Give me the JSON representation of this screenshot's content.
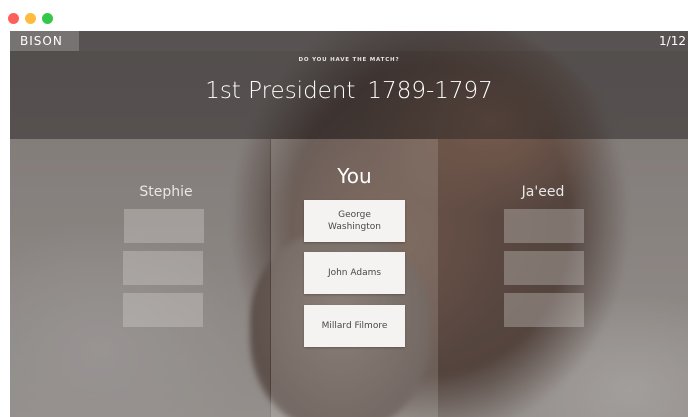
{
  "window": {
    "traffic_lights": [
      "close",
      "minimize",
      "zoom"
    ],
    "colors": {
      "close": "#fc605c",
      "minimize": "#fdbc40",
      "zoom": "#34c84a"
    }
  },
  "header": {
    "brand": "BISON",
    "progress": "1/12"
  },
  "banner": {
    "prompt": "DO YOU HAVE THE MATCH?",
    "question_title": "1st President",
    "question_years": "1789-1797"
  },
  "players": {
    "left": "Stephie",
    "center": "You",
    "right": "Ja'eed"
  },
  "choices": [
    {
      "label": "George Washington"
    },
    {
      "label": "John Adams"
    },
    {
      "label": "Millard Filmore"
    }
  ],
  "background": {
    "image": "bison-photo",
    "overlay_color": "#3c3838"
  }
}
